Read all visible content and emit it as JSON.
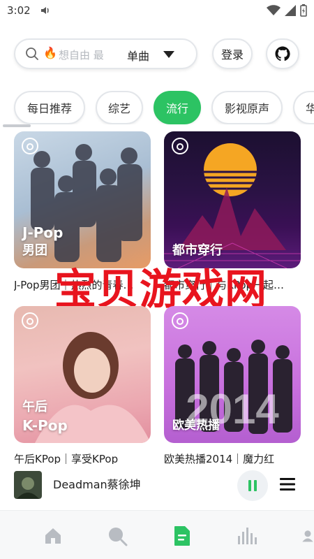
{
  "status_bar": {
    "time": "3:02"
  },
  "search": {
    "placeholder": "想自由 最",
    "type_label": "单曲"
  },
  "header": {
    "login_label": "登录"
  },
  "tabs": [
    {
      "label": "每日推荐"
    },
    {
      "label": "综艺"
    },
    {
      "label": "流行",
      "active": true
    },
    {
      "label": "影视原声"
    },
    {
      "label": "华"
    }
  ],
  "playlists": [
    {
      "tag_line1": "J-Pop",
      "tag_line2": "男团",
      "title": "J-Pop男团｜热烈的青春…"
    },
    {
      "tag_line1": "都市穿行",
      "tag_line2": "",
      "title": "都市穿行｜与KPop一起…"
    },
    {
      "tag_line1": "午后",
      "tag_line2": "K-Pop",
      "title": "午后KPop｜享受KPop"
    },
    {
      "tag_line1": "欧美热播",
      "tag_line2": "",
      "overlay_text": "2014",
      "title": "欧美热播2014｜魔力红"
    }
  ],
  "watermark": "宝贝游戏网",
  "player": {
    "title": "Deadman蔡徐坤"
  },
  "nav": [
    {
      "icon": "home-icon"
    },
    {
      "icon": "search-icon"
    },
    {
      "icon": "document-icon",
      "active": true
    },
    {
      "icon": "chart-icon"
    },
    {
      "icon": "user-icon"
    }
  ],
  "colors": {
    "accent": "#2cc363",
    "watermark": "#e8141e"
  }
}
